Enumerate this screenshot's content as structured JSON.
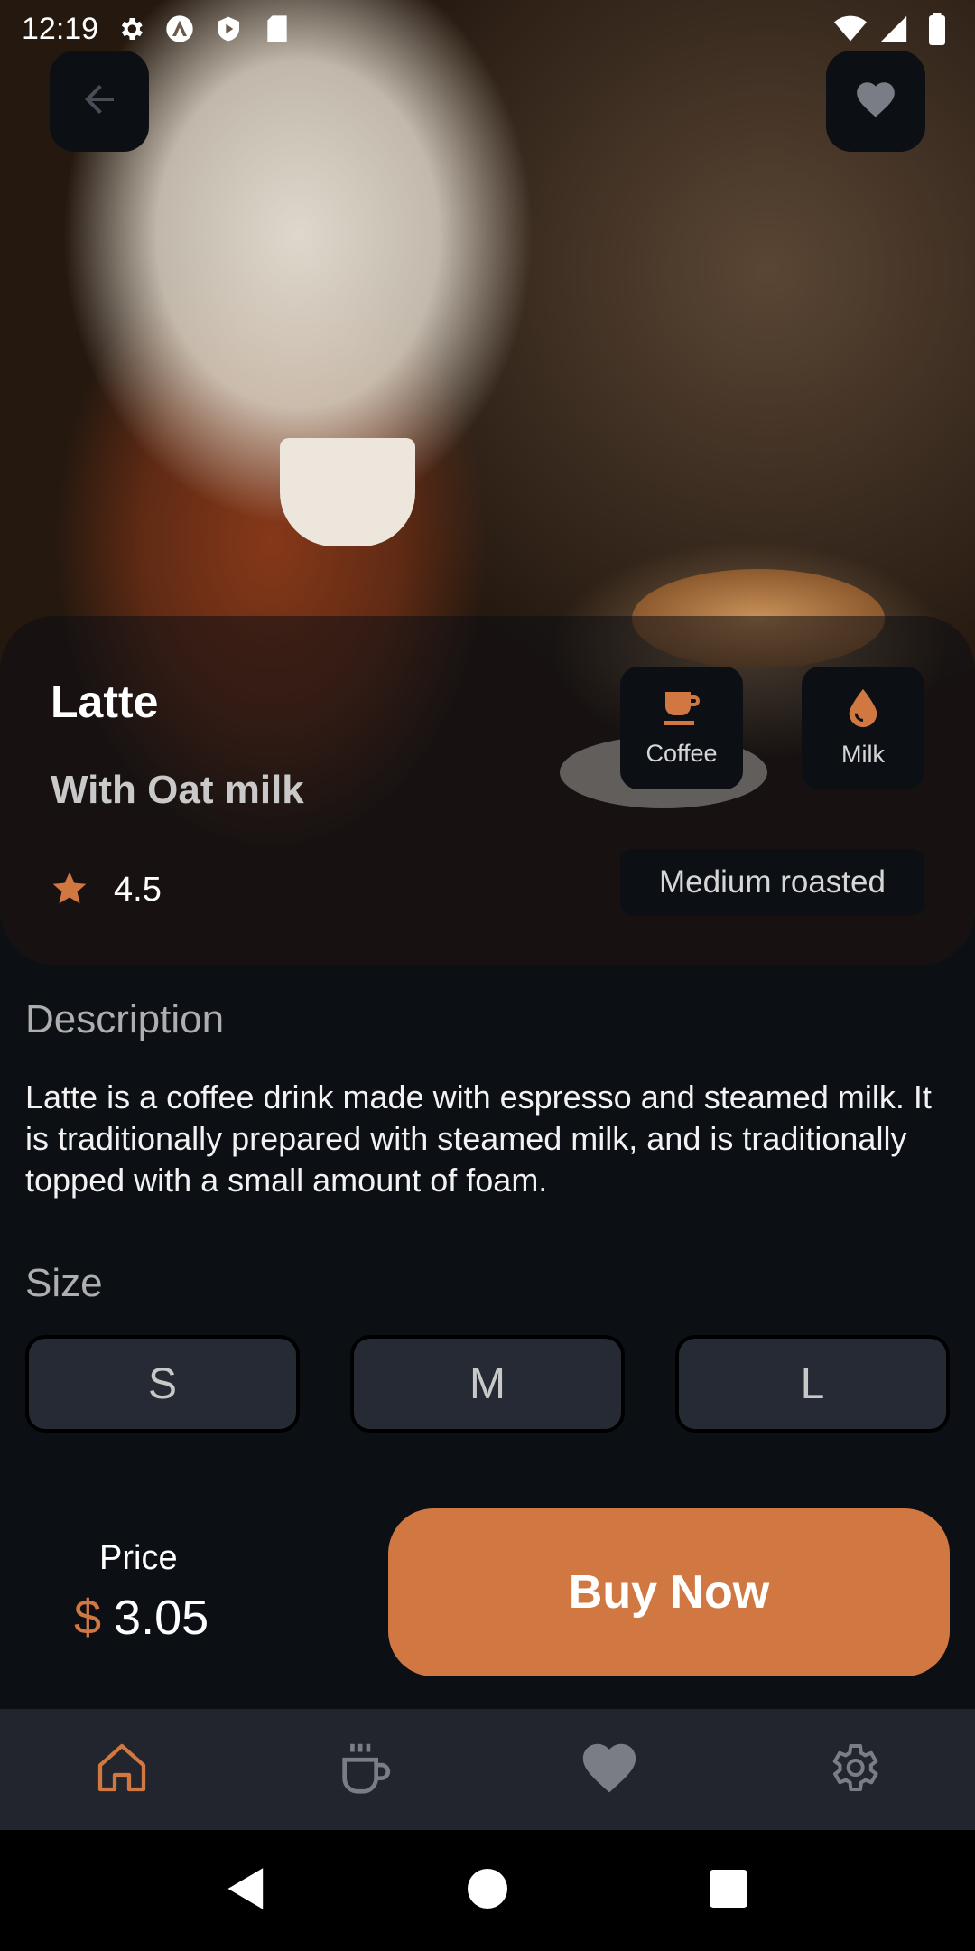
{
  "status_bar": {
    "time": "12:19",
    "left_icons": [
      "gear-icon",
      "shield-a-icon",
      "play-protect-icon",
      "sd-card-icon"
    ],
    "right_icons": [
      "wifi-icon",
      "signal-icon",
      "battery-icon"
    ]
  },
  "header": {
    "back_icon": "arrow-left-icon",
    "favorite_icon": "heart-icon"
  },
  "product": {
    "name": "Latte",
    "subtitle": "With Oat milk",
    "rating": "4.5",
    "tags": [
      {
        "label": "Coffee",
        "icon": "coffee-cup-icon"
      },
      {
        "label": "Milk",
        "icon": "drop-icon"
      }
    ],
    "roast": "Medium roasted"
  },
  "description": {
    "title": "Description",
    "text": "Latte is a coffee drink made with espresso and steamed milk. It is traditionally prepared with steamed milk, and is traditionally topped with a small amount of foam."
  },
  "size": {
    "title": "Size",
    "options": [
      "S",
      "M",
      "L"
    ]
  },
  "price": {
    "label": "Price",
    "currency": "$",
    "value": "3.05"
  },
  "buy_button": {
    "label": "Buy Now"
  },
  "bottom_nav": {
    "items": [
      "home-icon",
      "coffee-cup-icon",
      "heart-icon",
      "settings-icon"
    ],
    "active": "home-icon"
  },
  "colors": {
    "accent": "#d17842",
    "background": "#0c0f14",
    "surface": "#252a34",
    "nav_background": "#22252d"
  }
}
